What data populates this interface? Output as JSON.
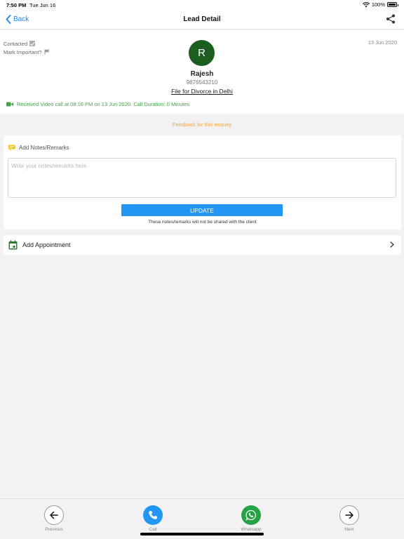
{
  "status_bar": {
    "time": "7:50 PM",
    "date": "Tue Jun 16",
    "battery": "100%"
  },
  "nav": {
    "back_label": "Back",
    "title": "Lead Detail"
  },
  "lead": {
    "contacted_label": "Contacted",
    "mark_important_label": "Mark Important?",
    "date": "13 Jun 2020",
    "avatar_initial": "R",
    "name": "Rajesh",
    "phone": "9876543210",
    "subject": "File for Divorce in Delhi",
    "call_log": "Received Video call at 08:16 PM on 13 Jun 2020. Call Duration: 0 Minutes"
  },
  "feedback_label": "Feedback for this enquiry",
  "notes": {
    "header": "Add Notes/Remarks",
    "value": "",
    "placeholder": "Write your notes/remarks here",
    "update_label": "UPDATE",
    "hint": "These notes/remarks will not be shared with the client"
  },
  "appointment": {
    "label": "Add Appointment"
  },
  "bottom_bar": {
    "previous_label": "Previous",
    "call_label": "Call",
    "whatsapp_label": "Whatsapp",
    "next_label": "Next"
  },
  "colors": {
    "accent_blue": "#2196f3",
    "avatar_green": "#1b5e20",
    "call_log_green": "#43a047",
    "feedback_orange": "#f4a53b",
    "whatsapp_green": "#25a244"
  }
}
